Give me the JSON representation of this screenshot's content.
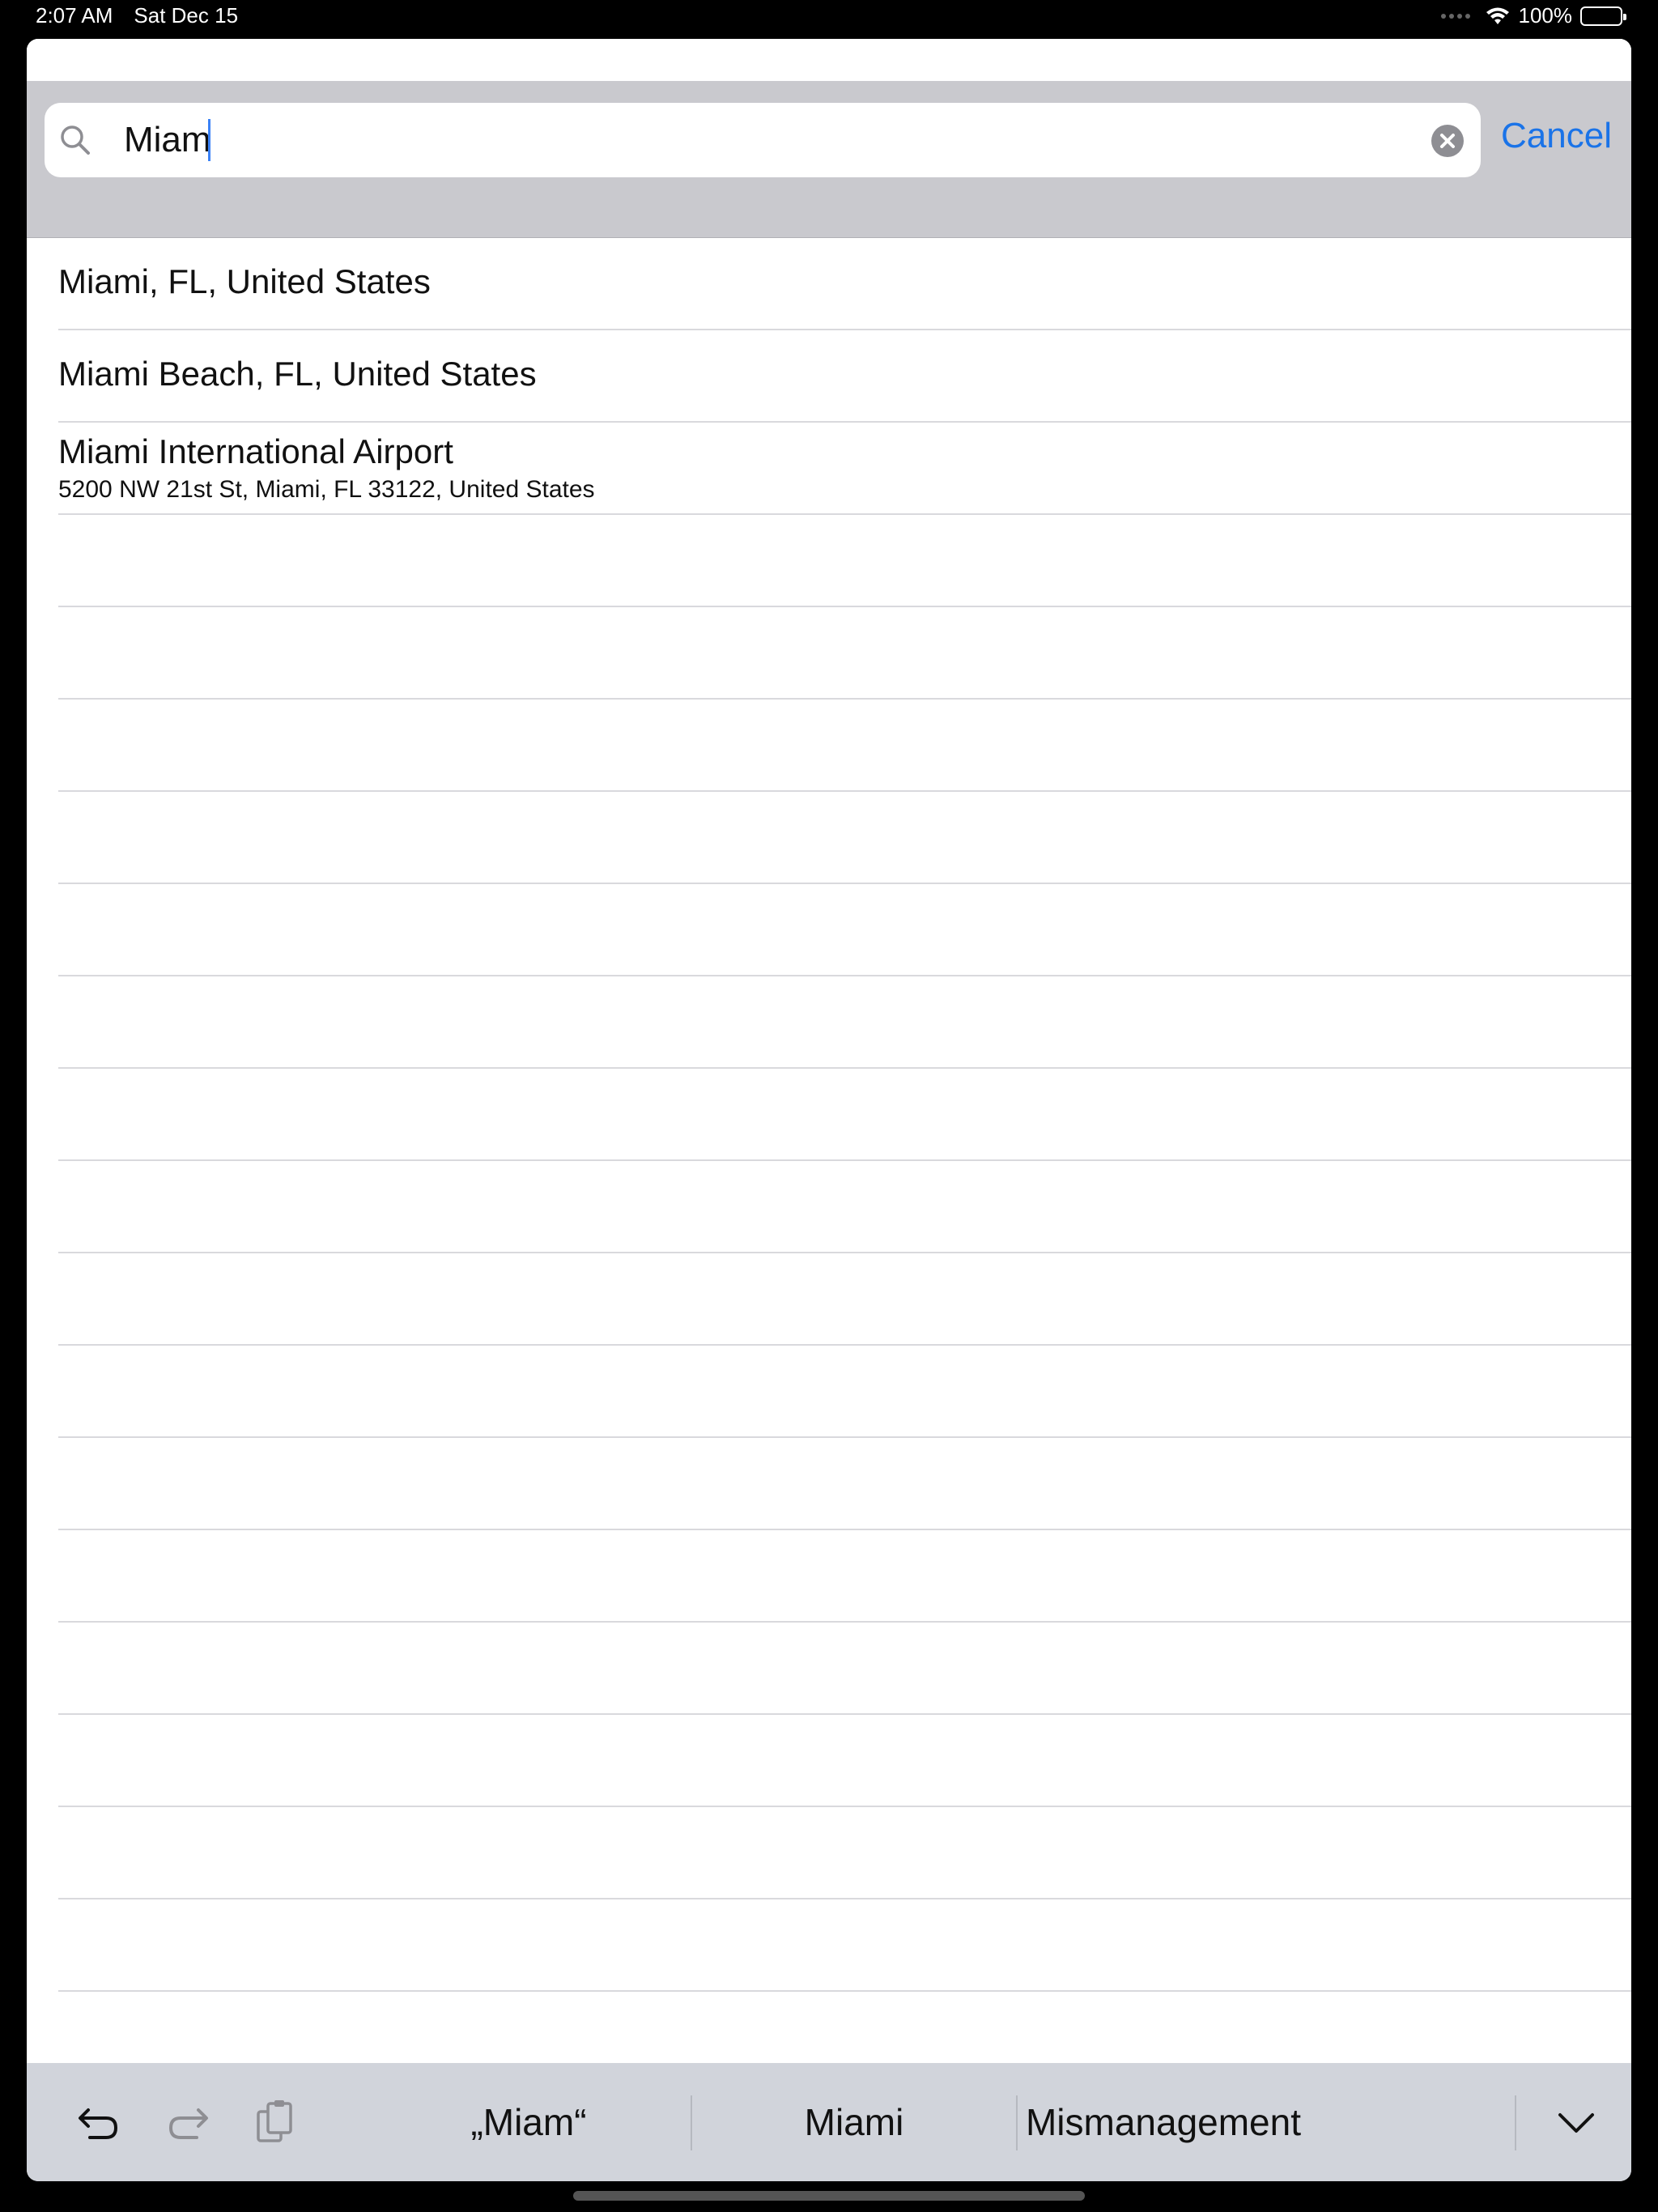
{
  "status_bar": {
    "time": "2:07 AM",
    "date": "Sat Dec 15",
    "battery": "100%",
    "icons": [
      "signal-icon",
      "wifi-icon",
      "battery-icon"
    ]
  },
  "search": {
    "query": "Miam",
    "cancel_label": "Cancel",
    "icons": [
      "search-icon",
      "clear-icon"
    ]
  },
  "results": [
    {
      "title": "Miami, FL, United States",
      "subtitle": ""
    },
    {
      "title": "Miami Beach, FL, United States",
      "subtitle": ""
    },
    {
      "title": "Miami International Airport",
      "subtitle": "5200 NW 21st St, Miami, FL  33122, United States"
    }
  ],
  "keyboard_bar": {
    "suggestions": [
      "„Miam“",
      "Miami",
      "Mismanagement"
    ],
    "icons": [
      "undo-icon",
      "redo-icon",
      "paste-icon",
      "keyboard-collapse-icon"
    ]
  },
  "colors": {
    "accent": "#1a73e8",
    "search_bar_bg": "#c9c9ce",
    "shortcut_bar_bg": "#d1d4db",
    "separator": "#d9d9dd"
  }
}
